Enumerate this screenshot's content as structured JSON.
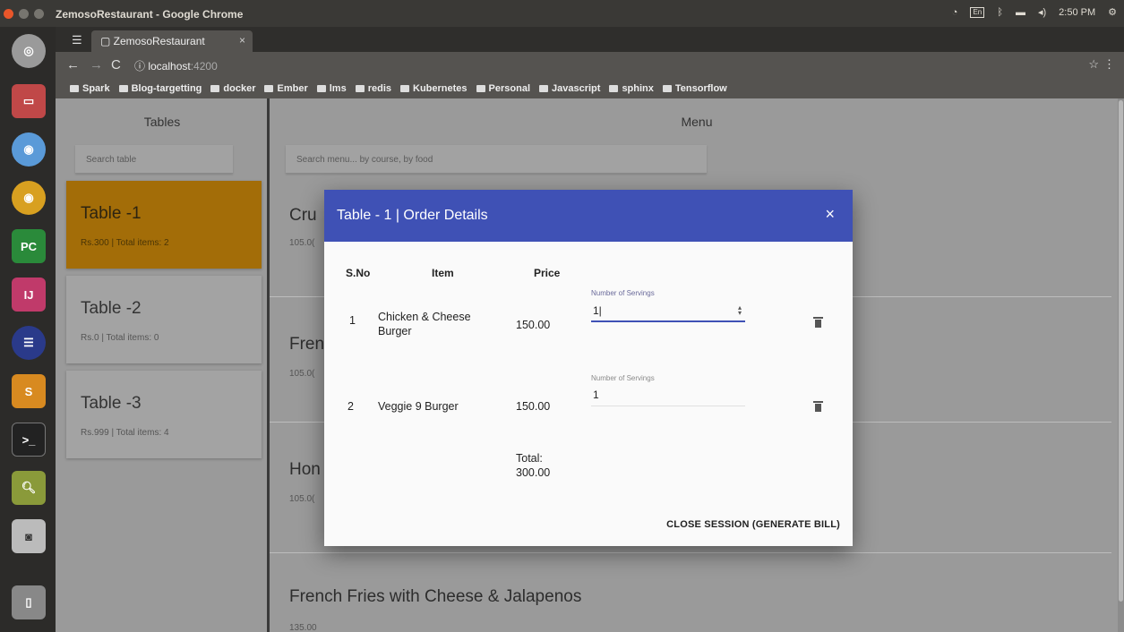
{
  "os": {
    "app_title": "ZemosoRestaurant - Google Chrome",
    "clock": "2:50 PM"
  },
  "browser": {
    "tab_title": "ZemosoRestaurant",
    "url_host": "localhost",
    "url_port": ":4200",
    "bookmarks": [
      "Spark",
      "Blog-targetting",
      "docker",
      "Ember",
      "lms",
      "redis",
      "Kubernetes",
      "Personal",
      "Javascript",
      "sphinx",
      "Tensorflow"
    ]
  },
  "tables_panel": {
    "title": "Tables",
    "search_placeholder": "Search table",
    "tables": [
      {
        "name": "Table -1",
        "meta": "Rs.300 | Total items: 2"
      },
      {
        "name": "Table -2",
        "meta": "Rs.0 | Total items: 0"
      },
      {
        "name": "Table -3",
        "meta": "Rs.999 | Total items: 4"
      }
    ]
  },
  "menu_panel": {
    "title": "Menu",
    "search_placeholder": "Search menu... by course, by food",
    "items": [
      {
        "name": "Cru",
        "price": "105.0("
      },
      {
        "name": "Fren",
        "price": "105.0("
      },
      {
        "name": "Hon",
        "price": "105.0("
      },
      {
        "name": "French Fries with Cheese & Jalapenos",
        "price": "135.00"
      }
    ]
  },
  "modal": {
    "title": "Table - 1 | Order Details",
    "close_icon": "×",
    "headers": {
      "sno": "S.No",
      "item": "Item",
      "price": "Price"
    },
    "rows": [
      {
        "sno": "1",
        "item_line1": "Chicken & Cheese",
        "item_line2": "Burger",
        "price": "150.00",
        "servings_label": "Number of Servings",
        "servings": "1|"
      },
      {
        "sno": "2",
        "item_line1": "Veggie 9 Burger",
        "item_line2": "",
        "price": "150.00",
        "servings_label": "Number of Servings",
        "servings": "1"
      }
    ],
    "total_label": "Total:",
    "total_value": "300.00",
    "close_session_label": "CLOSE SESSION (GENERATE BILL)"
  }
}
